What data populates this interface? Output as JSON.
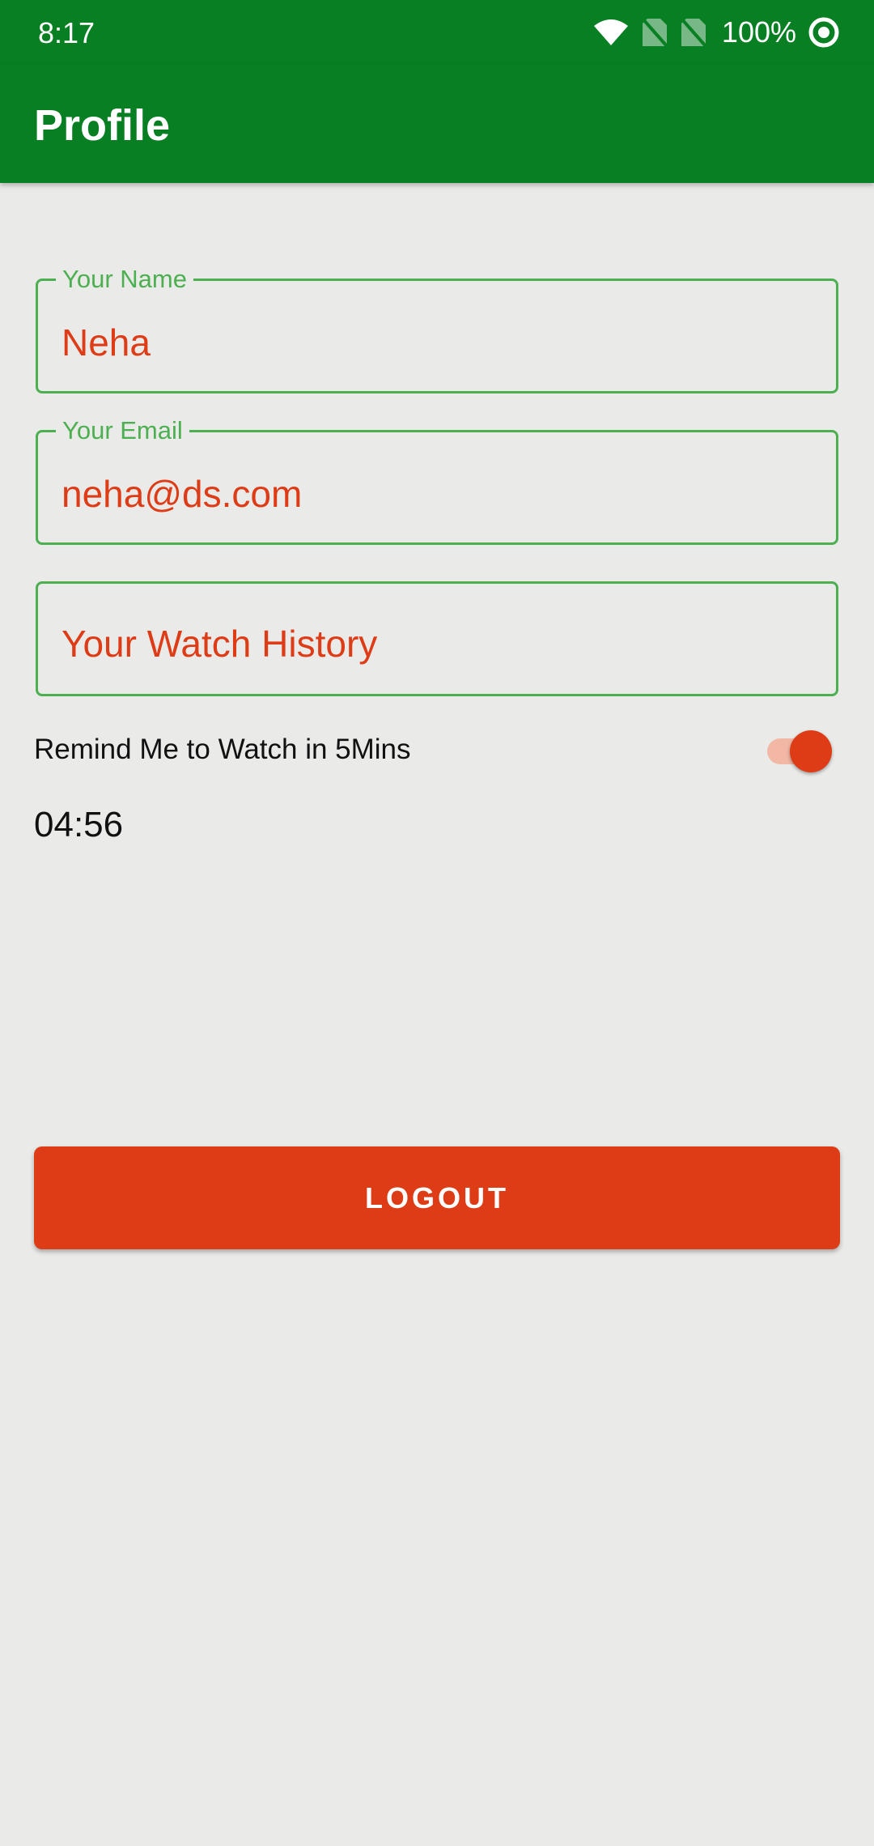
{
  "status_bar": {
    "time": "8:17",
    "battery": "100%",
    "icons": [
      "wifi-icon",
      "no-sim-icon",
      "no-sim-icon",
      "data-saver-icon"
    ]
  },
  "app_bar": {
    "title": "Profile"
  },
  "form": {
    "name": {
      "label": "Your Name",
      "value": "Neha"
    },
    "email": {
      "label": "Your Email",
      "value": "neha@ds.com"
    },
    "watch_history": {
      "placeholder": "Your Watch History"
    }
  },
  "reminder": {
    "label": "Remind Me to Watch in 5Mins",
    "enabled": true,
    "countdown": "04:56"
  },
  "logout": {
    "label": "LOGOUT"
  },
  "colors": {
    "primary": "#087F23",
    "accent": "#DD3C16",
    "field_border": "#4CAF50",
    "background": "#EAEBE9"
  }
}
